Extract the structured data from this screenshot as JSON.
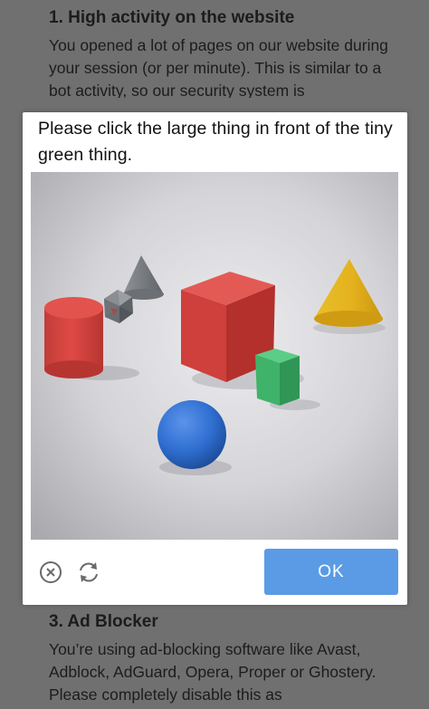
{
  "background": {
    "section1": {
      "heading": "1. High activity on the website",
      "text": "You opened a lot of pages on our website during your session (or per minute). This is similar to a bot activity, so our security system is automatically blocking you. Oth"
    },
    "section3": {
      "heading": "3. Ad Blocker",
      "text": "You’re using ad-blocking software like Avast, Adblock, AdGuard, Opera, Proper or Ghostery. Please completely disable this as"
    }
  },
  "captcha": {
    "prompt": "Please click the large thing in front of the tiny green thing.",
    "ok_label": "OK",
    "colors": {
      "accent": "#5b9be6",
      "red": "#d9423e",
      "green": "#3fb36a",
      "blue": "#2f6fd1",
      "yellow": "#e4b21e",
      "gray": "#7d8185"
    },
    "icons": [
      "close-circle-icon",
      "reload-icon"
    ],
    "scene_objects": [
      "red-cylinder",
      "gray-cone",
      "gray-icosahedron",
      "red-cube",
      "green-cube",
      "yellow-cone",
      "blue-sphere"
    ]
  }
}
